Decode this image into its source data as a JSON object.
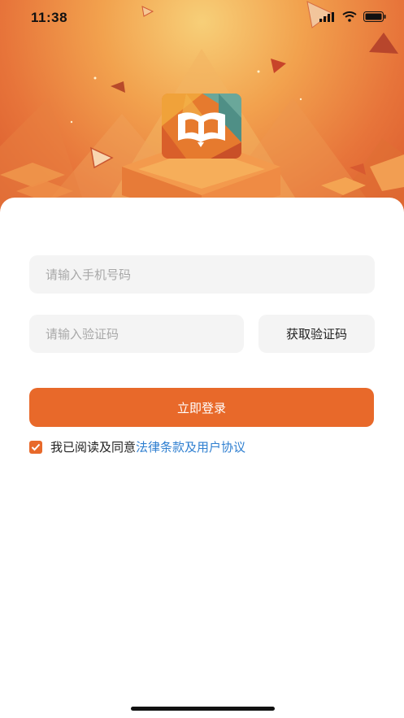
{
  "status_bar": {
    "time": "11:38"
  },
  "login_form": {
    "phone_placeholder": "请输入手机号码",
    "code_placeholder": "请输入验证码",
    "get_code_label": "获取验证码",
    "submit_label": "立即登录"
  },
  "agreement": {
    "checked": true,
    "text": "我已阅读及同意",
    "link_text": "法律条款及用户协议"
  },
  "colors": {
    "accent": "#e8692a",
    "link": "#2f7fd0",
    "field_bg": "#f4f4f4"
  }
}
